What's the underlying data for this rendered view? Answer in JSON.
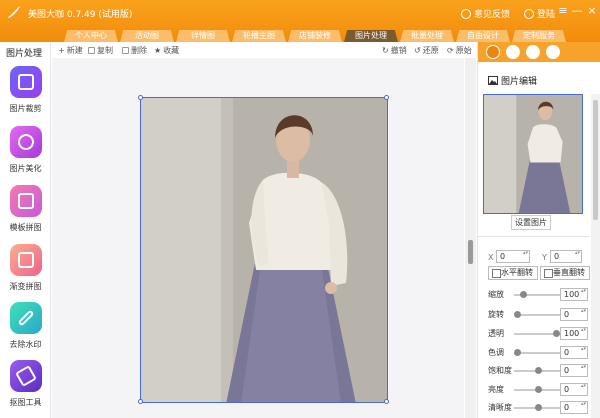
{
  "app": {
    "title": "美图大咖 0.7.49 (试用版)"
  },
  "titlebar": {
    "feedback": "意见反馈",
    "login": "登陆",
    "menu": "≡",
    "minimize": "—",
    "close": "×"
  },
  "tabs": [
    "个人中心",
    "活动图",
    "详情图",
    "轮播主图",
    "店铺装修",
    "图片处理",
    "批量处理",
    "自由设计",
    "定制服务"
  ],
  "sidebar": {
    "title": "图片处理",
    "items": [
      {
        "label": "图片裁剪",
        "color": "#7b4ff0"
      },
      {
        "label": "图片美化",
        "color": "#c44ce0"
      },
      {
        "label": "模板拼图",
        "color": "#f05fa0"
      },
      {
        "label": "渐变拼图",
        "color": "#f28c5a"
      },
      {
        "label": "去除水印",
        "color": "#2cc8a8"
      },
      {
        "label": "抠图工具",
        "color": "#7a3fd0"
      }
    ]
  },
  "toolbar": {
    "new": "新建",
    "copy": "复制",
    "delete": "删除",
    "favorite": "收藏",
    "redo": "撤销",
    "undo": "还原",
    "original": "原始"
  },
  "panel": {
    "heading": "图片编辑",
    "set_image": "设置图片",
    "x_label": "X",
    "y_label": "Y",
    "x_value": "0",
    "y_value": "0",
    "flip_h": "水平翻转",
    "flip_v": "垂直翻转",
    "adjust": [
      {
        "label": "缩放",
        "value": "100",
        "level": 0.15
      },
      {
        "label": "旋转",
        "value": "0",
        "level": 0.0
      },
      {
        "label": "透明",
        "value": "100",
        "level": 1.0
      },
      {
        "label": "色调",
        "value": "0",
        "level": 0.0
      },
      {
        "label": "饱和度",
        "value": "0",
        "level": 0.55
      },
      {
        "label": "亮度",
        "value": "0",
        "level": 0.55
      },
      {
        "label": "清晰度",
        "value": "0",
        "level": 0.55
      }
    ]
  },
  "colors": {
    "accent": "#f7a22a",
    "selection": "#4a6bd1"
  }
}
